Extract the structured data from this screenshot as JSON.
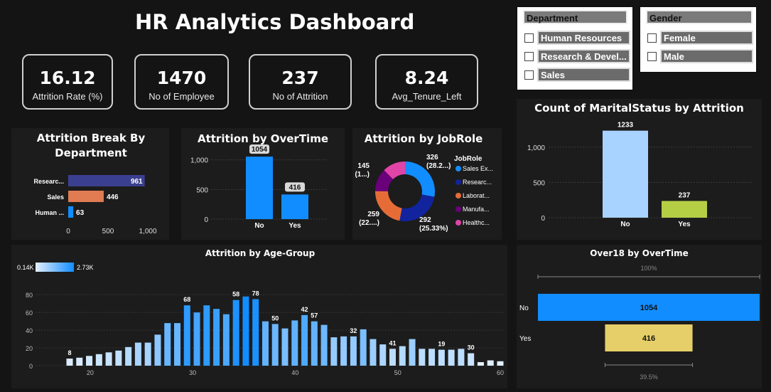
{
  "title": "HR Analytics Dashboard",
  "kpis": [
    {
      "value": "16.12",
      "label": "Attrition Rate (%)"
    },
    {
      "value": "1470",
      "label": "No of Employee"
    },
    {
      "value": "237",
      "label": "No of Attrition"
    },
    {
      "value": "8.24",
      "label": "Avg_Tenure_Left"
    }
  ],
  "slicers": {
    "department": {
      "header": "Department",
      "items": [
        "Human Resources",
        "Research & Devel...",
        "Sales"
      ]
    },
    "gender": {
      "header": "Gender",
      "items": [
        "Female",
        "Male"
      ]
    }
  },
  "colors": {
    "blue": "#118dff",
    "navy": "#3a3f8f",
    "orange": "#e07b52",
    "lightblue": "#a8d2ff",
    "green": "#b5cf45",
    "yellow": "#e6cf68"
  },
  "chart_data": [
    {
      "id": "dept",
      "type": "bar",
      "orientation": "horizontal",
      "title": "Attrition Break By Department",
      "categories": [
        "Researc...",
        "Sales",
        "Human ..."
      ],
      "values": [
        961,
        446,
        63
      ],
      "colors": [
        "#3a3f8f",
        "#e07b52",
        "#118dff"
      ],
      "xticks": [
        "0",
        "500",
        "1,000"
      ],
      "xlim": [
        0,
        1000
      ]
    },
    {
      "id": "overtime",
      "type": "bar",
      "title": "Attrition by OverTime",
      "categories": [
        "No",
        "Yes"
      ],
      "values": [
        1054,
        416
      ],
      "yticks": [
        "0",
        "500",
        "1,000"
      ],
      "ylim": [
        0,
        1200
      ]
    },
    {
      "id": "jobrole",
      "type": "pie",
      "title": "Attrition by JobRole",
      "legend_title": "JobRole",
      "labels": [
        "Sales Ex...",
        "Researc...",
        "Laborat...",
        "Manufa...",
        "Healthc..."
      ],
      "values": [
        326,
        292,
        259,
        145,
        145
      ],
      "colors": [
        "#118dff",
        "#12239e",
        "#e66c37",
        "#6b007b",
        "#e044a7"
      ],
      "data_labels": [
        {
          "value": "326",
          "pct": "(28.2...)"
        },
        {
          "value": "292",
          "pct": "(25.33%)"
        },
        {
          "value": "259",
          "pct": "(22....)"
        },
        {
          "value": "145",
          "pct": "(1...)"
        }
      ]
    },
    {
      "id": "marital",
      "type": "bar",
      "title": "Count of MaritalStatus by Attrition",
      "categories": [
        "No",
        "Yes"
      ],
      "values": [
        1233,
        237
      ],
      "colors": [
        "#a8d2ff",
        "#b5cf45"
      ],
      "yticks": [
        "0",
        "500",
        "1,000"
      ],
      "ylim": [
        0,
        1300
      ]
    },
    {
      "id": "age",
      "type": "bar",
      "title": "Attrition by Age-Group",
      "legend_min": "0.14K",
      "legend_max": "2.73K",
      "x": [
        18,
        19,
        20,
        21,
        22,
        23,
        24,
        25,
        26,
        27,
        28,
        29,
        30,
        31,
        32,
        33,
        34,
        35,
        36,
        37,
        38,
        39,
        40,
        41,
        42,
        43,
        44,
        45,
        46,
        47,
        48,
        49,
        50,
        51,
        52,
        53,
        54,
        55,
        56,
        57,
        58,
        59,
        60
      ],
      "values": [
        8,
        9,
        11,
        13,
        15,
        17,
        21,
        26,
        26,
        35,
        48,
        48,
        68,
        60,
        68,
        64,
        58,
        74,
        78,
        75,
        50,
        47,
        42,
        51,
        57,
        50,
        46,
        32,
        33,
        33,
        41,
        30,
        24,
        19,
        22,
        30,
        19,
        19,
        18,
        18,
        19,
        14,
        4,
        6,
        5
      ],
      "labeled_points": {
        "18": "8",
        "30": "68",
        "34": "58",
        "36": "78",
        "38": "50",
        "40": "42",
        "41": "57",
        "45": "32",
        "48": "41",
        "51": "19",
        "53": "30",
        "58": "4",
        "60": "5"
      },
      "yticks": [
        "0",
        "20",
        "40",
        "60",
        "80"
      ],
      "xticks": [
        "20",
        "30",
        "40",
        "50",
        "60"
      ],
      "ylim": [
        0,
        85
      ]
    },
    {
      "id": "over18",
      "type": "bar",
      "orientation": "horizontal",
      "title": "Over18 by OverTime",
      "categories": [
        "No",
        "Yes"
      ],
      "values": [
        1054,
        416
      ],
      "colors": [
        "#118dff",
        "#e6cf68"
      ],
      "top_label": "100%",
      "bottom_label": "39.5%"
    }
  ]
}
